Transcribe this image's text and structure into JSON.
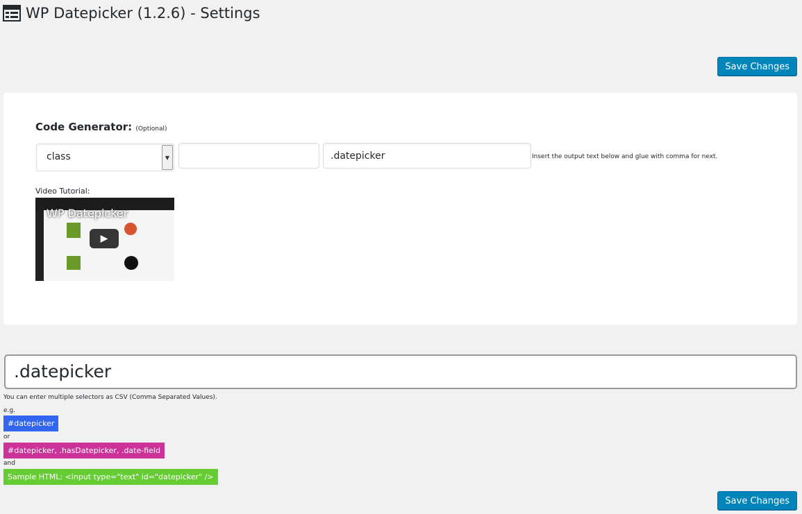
{
  "header": {
    "title": "WP Datepicker (1.2.6) - Settings",
    "icon": "table-settings-icon"
  },
  "buttons": {
    "save_top": "Save Changes",
    "save_bottom": "Save Changes"
  },
  "code_generator": {
    "title": "Code Generator:",
    "optional": "(Optional)",
    "select_value": "class",
    "name_input_value": "",
    "output_value": ".datepicker",
    "hint": "Insert the output text below and glue with comma for next."
  },
  "video": {
    "label": "Video Tutorial:",
    "title": "WP Datepicker"
  },
  "selector_input": {
    "value": ".datepicker"
  },
  "help": {
    "csv_note": "You can enter multiple selectors as CSV (Comma Separated Values).",
    "eg": "e.g.",
    "example1": "#datepicker",
    "or": "or",
    "example2": "#datepicker, .hasDatepicker, .date-field",
    "and": "and",
    "example3": "Sample HTML: <input type=\"text\" id=\"datepicker\" />"
  },
  "colors": {
    "primary": "#0085ba",
    "chip_blue": "#3366ee",
    "chip_pink": "#cc3399",
    "chip_green": "#66cc33"
  }
}
